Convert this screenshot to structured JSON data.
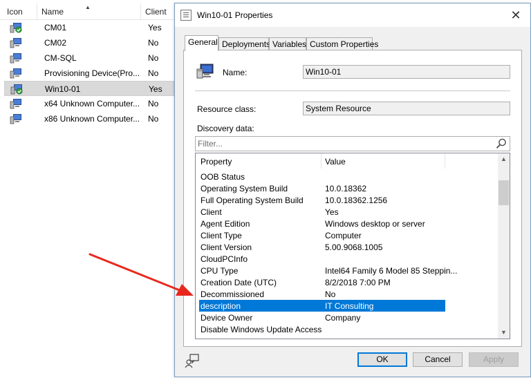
{
  "device_list": {
    "columns": {
      "icon": "Icon",
      "name": "Name",
      "client": "Client"
    },
    "rows": [
      {
        "name": "CM01",
        "client": "Yes",
        "icon": "computer-check-icon",
        "selected": false
      },
      {
        "name": "CM02",
        "client": "No",
        "icon": "computer-icon",
        "selected": false
      },
      {
        "name": "CM-SQL",
        "client": "No",
        "icon": "computer-icon",
        "selected": false
      },
      {
        "name": "Provisioning Device(Pro...",
        "client": "No",
        "icon": "computer-icon",
        "selected": false
      },
      {
        "name": "Win10-01",
        "client": "Yes",
        "icon": "computer-check-icon",
        "selected": true
      },
      {
        "name": "x64 Unknown Computer...",
        "client": "No",
        "icon": "computer-icon",
        "selected": false
      },
      {
        "name": "x86 Unknown Computer...",
        "client": "No",
        "icon": "computer-icon",
        "selected": false
      }
    ]
  },
  "dialog": {
    "title": "Win10-01 Properties",
    "close_glyph": "✕",
    "tabs": [
      {
        "label": "General",
        "active": true
      },
      {
        "label": "Deployments",
        "active": false
      },
      {
        "label": "Variables",
        "active": false
      },
      {
        "label": "Custom Properties",
        "active": false
      }
    ],
    "general": {
      "name_label": "Name:",
      "name_value": "Win10-01",
      "resource_class_label": "Resource class:",
      "resource_class_value": "System Resource",
      "discovery_label": "Discovery data:",
      "filter_placeholder": "Filter..."
    },
    "grid": {
      "columns": {
        "property": "Property",
        "value": "Value"
      },
      "rows": [
        {
          "property": "OOB Status",
          "value": ""
        },
        {
          "property": "Operating System Build",
          "value": "10.0.18362"
        },
        {
          "property": "Full Operating System Build",
          "value": "10.0.18362.1256"
        },
        {
          "property": "Client",
          "value": "Yes"
        },
        {
          "property": "Agent Edition",
          "value": "Windows desktop or server"
        },
        {
          "property": "Client Type",
          "value": "Computer"
        },
        {
          "property": "Client Version",
          "value": "5.00.9068.1005"
        },
        {
          "property": "CloudPCInfo",
          "value": ""
        },
        {
          "property": "CPU Type",
          "value": "Intel64 Family 6 Model 85 Steppin..."
        },
        {
          "property": "Creation Date (UTC)",
          "value": "8/2/2018 7:00 PM"
        },
        {
          "property": "Decommissioned",
          "value": "No"
        },
        {
          "property": "description",
          "value": "IT Consulting",
          "selected": true
        },
        {
          "property": "Device Owner",
          "value": "Company"
        },
        {
          "property": "Disable Windows Update Access",
          "value": ""
        }
      ]
    },
    "buttons": {
      "ok": "OK",
      "cancel": "Cancel",
      "apply": "Apply"
    }
  },
  "colors": {
    "selection": "#0078d7",
    "annotation_arrow": "#e8281e",
    "dialog_border": "#7a9cc0",
    "window_bg": "#f0f0f0"
  }
}
